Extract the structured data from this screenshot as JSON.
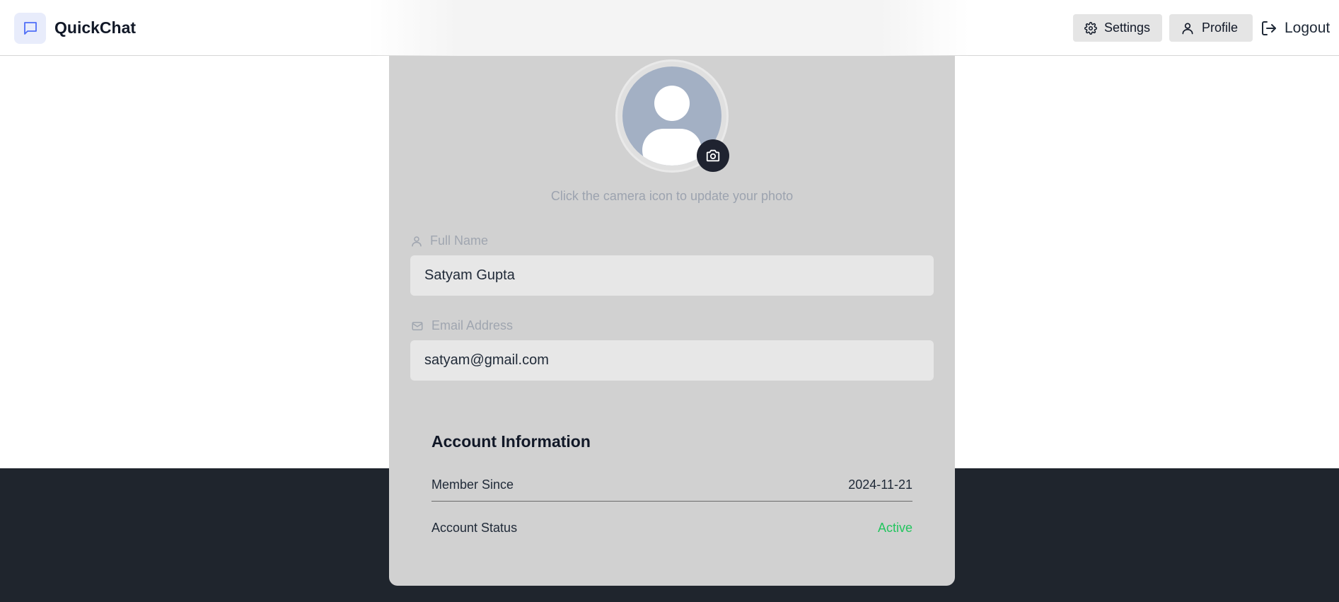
{
  "app": {
    "name": "QuickChat",
    "logo_icon": "chat-bubble-icon"
  },
  "nav": {
    "settings_label": "Settings",
    "profile_label": "Profile",
    "logout_label": "Logout"
  },
  "profile": {
    "photo_hint": "Click the camera icon to update your photo",
    "full_name_label": "Full Name",
    "full_name_value": "Satyam Gupta",
    "email_label": "Email Address",
    "email_value": "satyam@gmail.com"
  },
  "account": {
    "title": "Account Information",
    "member_since_label": "Member Since",
    "member_since_value": "2024-11-21",
    "status_label": "Account Status",
    "status_value": "Active"
  },
  "colors": {
    "header_bg": "#ffffff",
    "footer_bg": "#1f252d",
    "card_bg": "#d1d1d1",
    "status_active": "#22c55e",
    "logo_accent": "#4f6ef7"
  }
}
